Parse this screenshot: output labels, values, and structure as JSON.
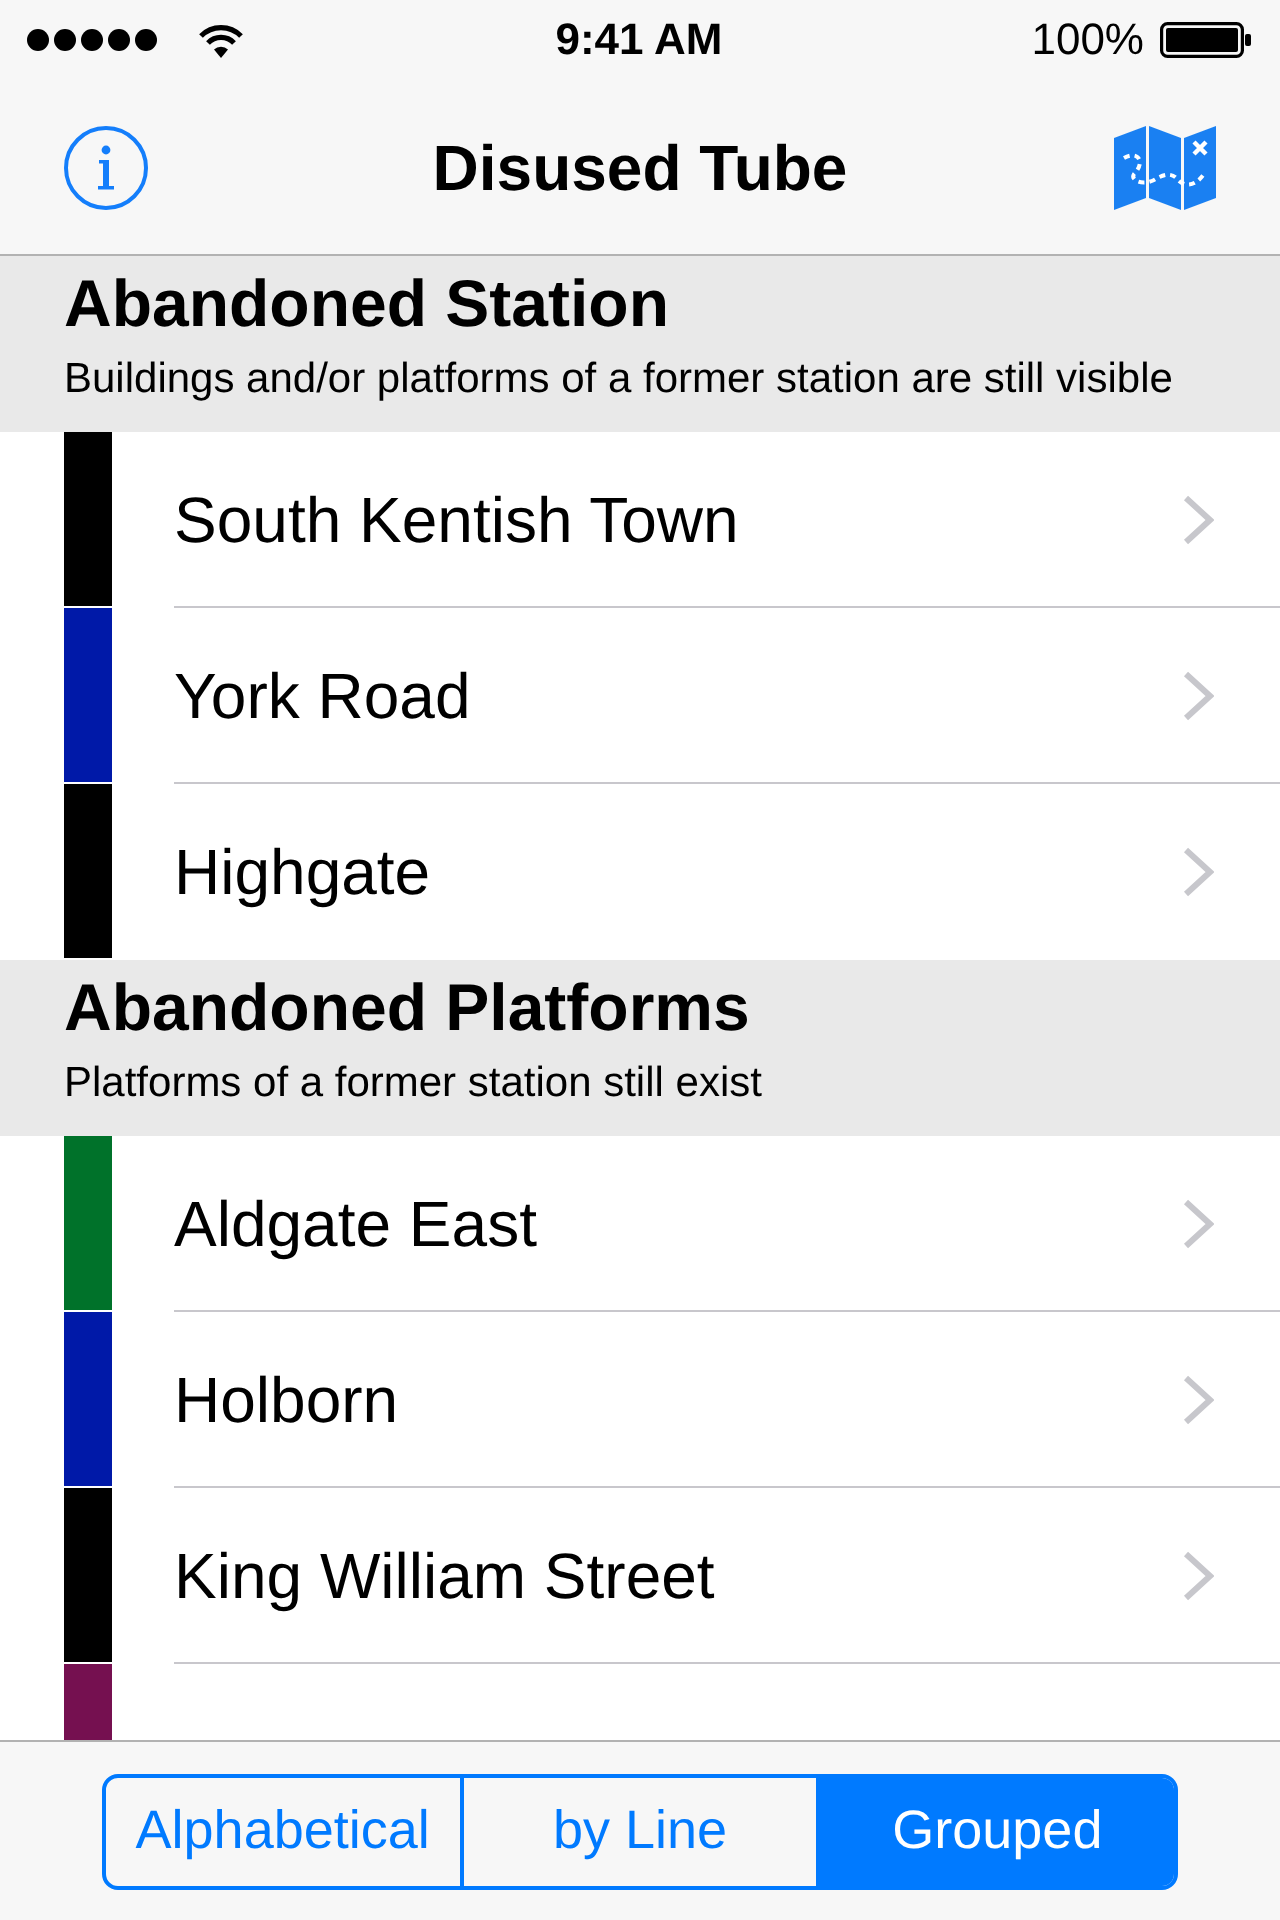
{
  "status_bar": {
    "time": "9:41 AM",
    "battery": "100%"
  },
  "nav_bar": {
    "title": "Disused Tube"
  },
  "sections": [
    {
      "title": "Abandoned Station",
      "subtitle": "Buildings and/or platforms of a former station are still visible",
      "rows": [
        {
          "name": "South Kentish Town",
          "color": "#000000"
        },
        {
          "name": "York Road",
          "color": "#0019a8"
        },
        {
          "name": "Highgate",
          "color": "#000000"
        }
      ]
    },
    {
      "title": "Abandoned Platforms",
      "subtitle": "Platforms of a former station still exist",
      "rows": [
        {
          "name": "Aldgate East",
          "color": "#00722a"
        },
        {
          "name": "Holborn",
          "color": "#0019a8"
        },
        {
          "name": "King William Street",
          "color": "#000000"
        },
        {
          "color": "#751050"
        }
      ]
    }
  ],
  "segments": [
    {
      "label": "Alphabetical",
      "selected": false
    },
    {
      "label": "by Line",
      "selected": false
    },
    {
      "label": "Grouped",
      "selected": true
    }
  ]
}
